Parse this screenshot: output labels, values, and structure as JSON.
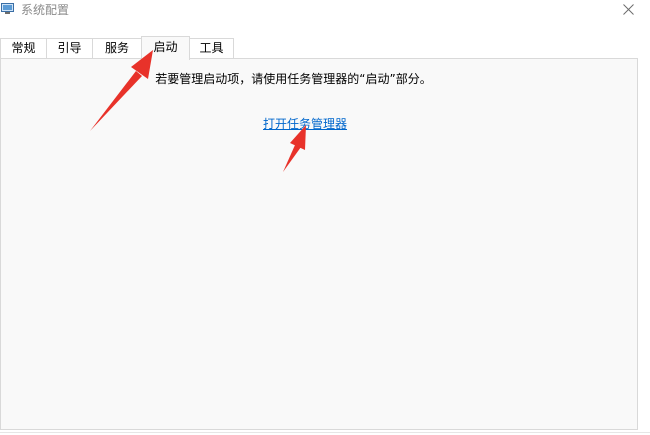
{
  "window": {
    "title": "系统配置",
    "icons": {
      "app": "msconfig-app-icon",
      "close": "close-icon"
    }
  },
  "tabs": [
    {
      "label": "常规",
      "active": false
    },
    {
      "label": "引导",
      "active": false
    },
    {
      "label": "服务",
      "active": false
    },
    {
      "label": "启动",
      "active": true
    },
    {
      "label": "工具",
      "active": false
    }
  ],
  "content": {
    "message": "若要管理启动项，请使用任务管理器的“启动”部分。",
    "link": "打开任务管理器"
  },
  "annotations": {
    "arrow_color": "#e8322a"
  },
  "colors": {
    "link": "#0066cc",
    "panel_bg": "#f9f9f9",
    "border": "#d9d9d9"
  }
}
